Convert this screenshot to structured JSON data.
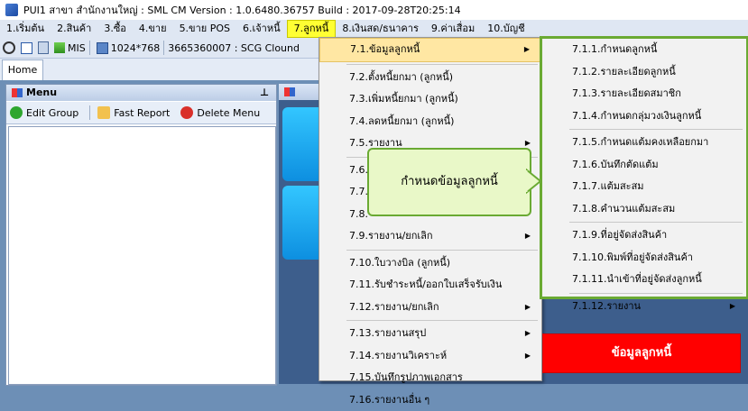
{
  "window": {
    "title": "PUI1 สาขา สำนักงานใหญ่ : SML CM Version : 1.0.6480.36757  Build : 2017-09-28T20:25:14"
  },
  "menubar": {
    "items": [
      "1.เริ่มต้น",
      "2.สินค้า",
      "3.ซื้อ",
      "4.ขาย",
      "5.ขาย POS",
      "6.เจ้าหนี้",
      "7.ลูกหนี้",
      "8.เงินสด/ธนาคาร",
      "9.ค่าเสื่อม",
      "10.บัญชี"
    ]
  },
  "toolbar": {
    "mis": "MIS",
    "resolution": "1024*768",
    "company": "3665360007 : SCG Clound"
  },
  "tabs": {
    "home": "Home"
  },
  "menu_panel": {
    "title": "Menu",
    "edit_group": "Edit Group",
    "fast_report": "Fast Report",
    "delete_menu": "Delete Menu"
  },
  "dropdown": {
    "items": [
      "7.1.ข้อมูลลูกหนี้",
      "7.2.ตั้งหนี้ยกมา (ลูกหนี้)",
      "7.3.เพิ่มหนี้ยกมา (ลูกหนี้)",
      "7.4.ลดหนี้ยกมา (ลูกหนี้)",
      "7.5.รายงาน",
      "7.6.",
      "7.7.",
      "7.8.",
      "7.9.รายงาน/ยกเลิก",
      "7.10.ใบวางบิล (ลูกหนี้)",
      "7.11.รับชำระหนี้/ออกใบเสร็จรับเงิน",
      "7.12.รายงาน/ยกเลิก",
      "7.13.รายงานสรุป",
      "7.14.รายงานวิเคราะห์",
      "7.15.บันทึกรูปภาพเอกสาร",
      "7.16.รายงานอื่น ๆ"
    ]
  },
  "submenu": {
    "items": [
      "7.1.1.กำหนดลูกหนี้",
      "7.1.2.รายละเอียดลูกหนี้",
      "7.1.3.รายละเอียดสมาชิก",
      "7.1.4.กำหนดกลุ่มวงเงินลูกหนี้",
      "7.1.5.กำหนดแต้มคงเหลือยกมา",
      "7.1.6.บันทึกตัดแต้ม",
      "7.1.7.แต้มสะสม",
      "7.1.8.คำนวนแต้มสะสม",
      "7.1.9.ที่อยู่จัดส่งสินค้า",
      "7.1.10.พิมพ์ที่อยู่จัดส่งสินค้า",
      "7.1.11.นำเข้าที่อยู่จัดส่งลูกหนี้",
      "7.1.12.รายงาน"
    ]
  },
  "callout": {
    "text": "กำหนดข้อมูลลูกหนี้"
  },
  "red_button": {
    "label": "ข้อมูลลูกหนี้"
  },
  "colors": {
    "highlight_menu": "#ffff33",
    "callout_border": "#6aaa33",
    "red_button": "#ff0000"
  }
}
